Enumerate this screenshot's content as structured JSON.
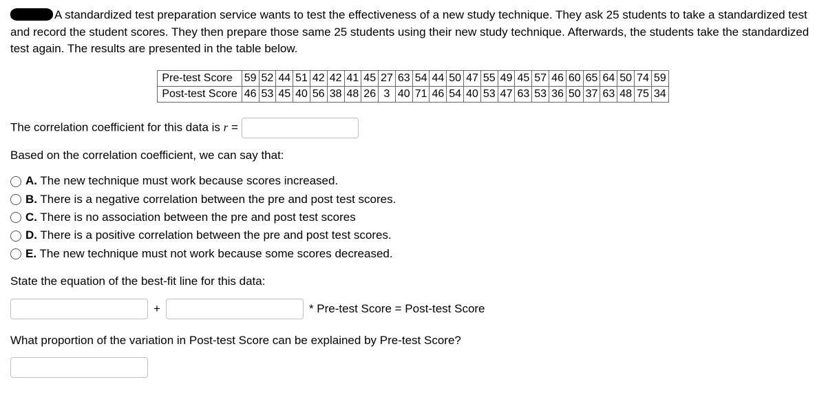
{
  "intro": "A standardized test preparation service wants to test the effectiveness of a new study technique. They ask 25 students to take a standardized test and record the student scores. They then prepare those same 25 students using their new study technique. Afterwards, the students take the standardized test again. The results are presented in the table below.",
  "table": {
    "row1_label": "Pre-test Score",
    "row2_label": "Post-test Score",
    "pre": [
      59,
      52,
      44,
      51,
      42,
      42,
      41,
      45,
      27,
      63,
      54,
      44,
      50,
      47,
      55,
      49,
      45,
      57,
      46,
      60,
      65,
      64,
      50,
      74,
      59
    ],
    "post": [
      46,
      53,
      45,
      40,
      56,
      38,
      48,
      26,
      3,
      40,
      71,
      46,
      54,
      40,
      53,
      47,
      63,
      53,
      36,
      50,
      37,
      63,
      48,
      75,
      34
    ]
  },
  "corr_line_prefix": "The correlation coefficient for this data is ",
  "corr_symbol": "r =",
  "based_line": "Based on the correlation coefficient, we can say that:",
  "options": [
    {
      "letter": "A.",
      "text": " The new technique must work because scores increased."
    },
    {
      "letter": "B.",
      "text": " There is a negative correlation between the pre and post test scores."
    },
    {
      "letter": "C.",
      "text": " There is no association between the pre and post test scores"
    },
    {
      "letter": "D.",
      "text": " There is a positive correlation between the pre and post test scores."
    },
    {
      "letter": "E.",
      "text": " The new technique must not work because some scores decreased."
    }
  ],
  "bestfit_line": "State the equation of the best-fit line for this data:",
  "eq_plus": "+",
  "eq_suffix": "* Pre-test Score = Post-test Score",
  "proportion_line": "What proportion of the variation in Post-test Score can be explained by Pre-test Score?"
}
